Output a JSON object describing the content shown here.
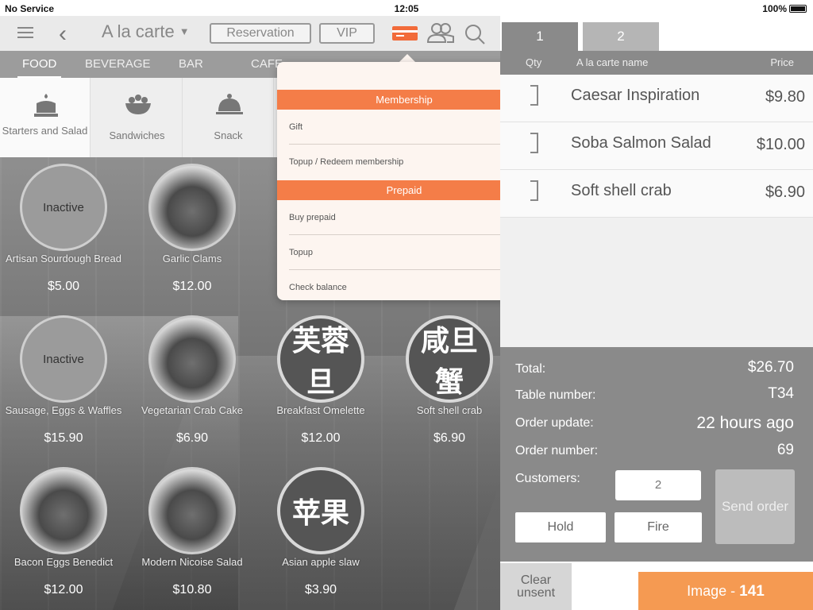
{
  "status_bar": {
    "carrier": "No Service",
    "time": "12:05",
    "battery": "100%"
  },
  "header": {
    "title": "A la carte",
    "reservation_label": "Reservation",
    "vip_label": "VIP",
    "card_icon": "credit-card-icon",
    "people_icon": "customers-icon",
    "search_icon": "search-icon",
    "accent_color": "#f26b3a"
  },
  "categories": [
    {
      "label": "FOOD",
      "active": true
    },
    {
      "label": "BEVERAGE"
    },
    {
      "label": "BAR"
    },
    {
      "label": "CAFE"
    }
  ],
  "subcategories": [
    {
      "label": "Starters and Salad",
      "icon": "cake-icon",
      "active": true
    },
    {
      "label": "Sandwiches",
      "icon": "salad-bowl-icon"
    },
    {
      "label": "Snack",
      "icon": "cloche-icon"
    }
  ],
  "products": [
    {
      "name": "Artisan Sourdough Bread",
      "price": "$5.00",
      "circle_text": "Inactive",
      "kind": "inactive"
    },
    {
      "name": "Garlic Clams",
      "price": "$12.00",
      "kind": "photo"
    },
    {
      "name": "Sausage, Eggs & Waffles",
      "price": "$15.90",
      "circle_text": "Inactive",
      "kind": "inactive"
    },
    {
      "name": "Vegetarian Crab Cake",
      "price": "$6.90",
      "kind": "photo"
    },
    {
      "name": "Breakfast Omelette",
      "price": "$12.00",
      "circle_text": "芙蓉旦",
      "kind": "cn"
    },
    {
      "name": "Soft shell crab",
      "price": "$6.90",
      "circle_text": "咸旦蟹",
      "kind": "cn"
    },
    {
      "name": "Bacon Eggs Benedict",
      "price": "$12.00",
      "kind": "photo"
    },
    {
      "name": "Modern Nicoise Salad",
      "price": "$10.80",
      "kind": "photo"
    },
    {
      "name": "Asian apple slaw",
      "price": "$3.90",
      "circle_text": "苹果",
      "kind": "cn"
    }
  ],
  "popup": {
    "sections": [
      {
        "title": "Membership",
        "items": [
          "Gift",
          "Topup / Redeem membership"
        ]
      },
      {
        "title": "Prepaid",
        "items": [
          "Buy prepaid",
          "Topup",
          "Check balance"
        ]
      }
    ],
    "header_color": "#f47d48"
  },
  "order": {
    "tabs": [
      "1",
      "2"
    ],
    "headers": {
      "qty": "Qty",
      "name": "A la carte name",
      "price": "Price"
    },
    "items": [
      {
        "name": "Caesar Inspiration",
        "price": "$9.80"
      },
      {
        "name": "Soba Salmon Salad",
        "price": "$10.00"
      },
      {
        "name": "Soft shell crab",
        "price": "$6.90"
      }
    ]
  },
  "totals": {
    "total_label": "Total:",
    "total_value": "$26.70",
    "table_label": "Table number:",
    "table_value": "T34",
    "update_label": "Order update:",
    "update_value": "22 hours ago",
    "order_label": "Order number:",
    "order_value": "69",
    "customers_label": "Customers:",
    "customers_value": "2",
    "hold_label": "Hold",
    "fire_label": "Fire",
    "send_label": "Send order"
  },
  "bottom": {
    "clear_label": "Clear unsent",
    "image_label": "Image -",
    "image_number": "141",
    "badge_color": "#f59a52"
  }
}
